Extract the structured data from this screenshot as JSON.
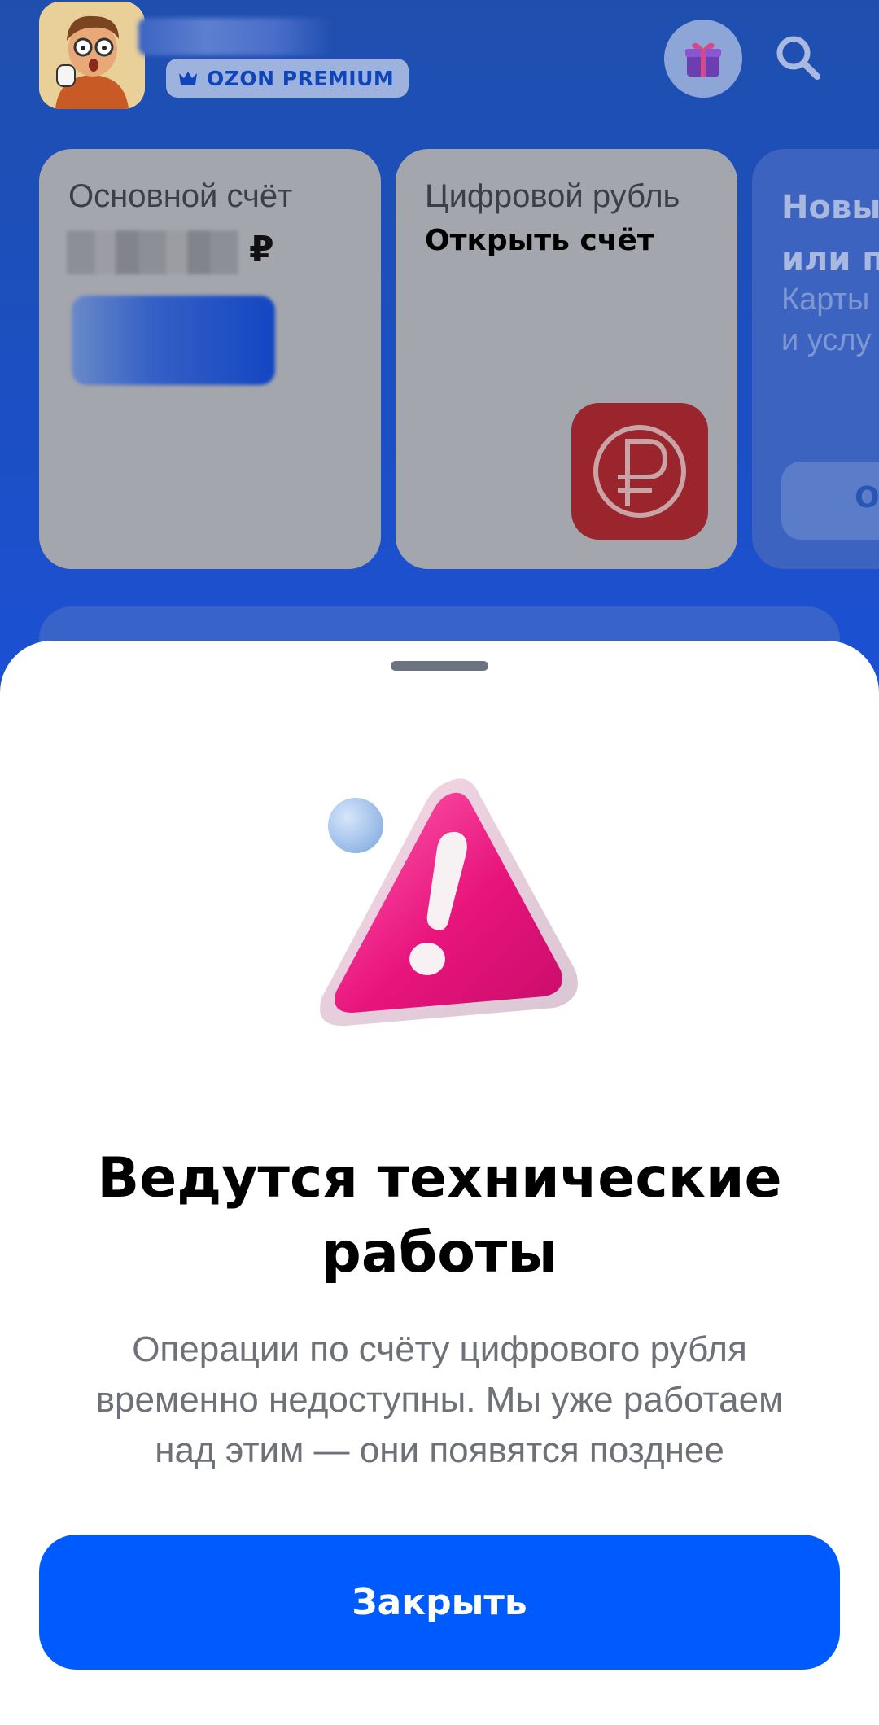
{
  "header": {
    "premium_label": "OZON PREMIUM"
  },
  "cards": {
    "main": {
      "label": "Основной счёт",
      "currency": "₽"
    },
    "digital": {
      "label": "Цифровой рубль",
      "action": "Открыть счёт"
    },
    "new": {
      "title": "Новы\nили п",
      "subtitle": "Карты\nи услу",
      "button": "О"
    }
  },
  "sheet": {
    "title": "Ведутся технические\nработы",
    "text": "Операции по счёту цифрового рубля\nвременно недоступны. Мы уже работаем\nнад этим — они появятся позднее",
    "close_button": "Закрыть"
  },
  "colors": {
    "accent": "#005bff",
    "warning_pink": "#e8147c",
    "cbr_red": "#9a252d"
  }
}
